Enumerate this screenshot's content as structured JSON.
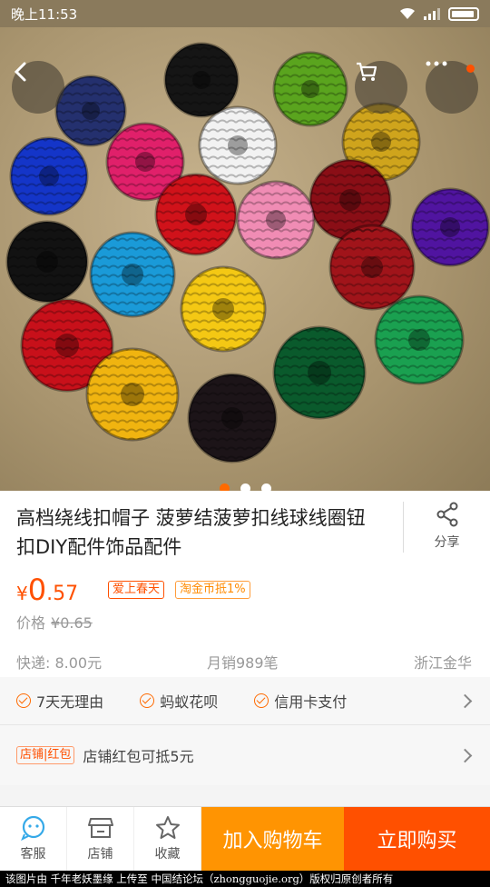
{
  "status_bar": {
    "time": "晚上11:53"
  },
  "product": {
    "title": "高档绕线扣帽子 菠萝结菠萝扣线球线圈钮扣DIY配件饰品配件",
    "share_label": "分享",
    "currency": "¥",
    "price_int": "0",
    "price_dec": ".57",
    "tags": [
      "爱上春天",
      "淘金币抵1%"
    ],
    "orig_price_label": "价格",
    "orig_price": "¥0.65",
    "shipping": "快递: 8.00元",
    "monthly_sales": "月销989笔",
    "location": "浙江金华"
  },
  "services": [
    "7天无理由",
    "蚂蚁花呗",
    "信用卡支付"
  ],
  "coupon": {
    "tag": "店铺|红包",
    "text": "店铺红包可抵5元"
  },
  "bottom_bar": {
    "service_label": "客服",
    "shop_label": "店铺",
    "fav_label": "收藏",
    "add_cart_label": "加入购物车",
    "buy_now_label": "立即购买"
  },
  "carousel": {
    "total": 3,
    "active": 1
  },
  "colors": {
    "accent": "#ff5000",
    "cart": "#ff9402"
  },
  "watermark": "该图片由 千年老妖墨缘 上传至 中国结论坛（zhongguojie.org）版权归原创者所有"
}
